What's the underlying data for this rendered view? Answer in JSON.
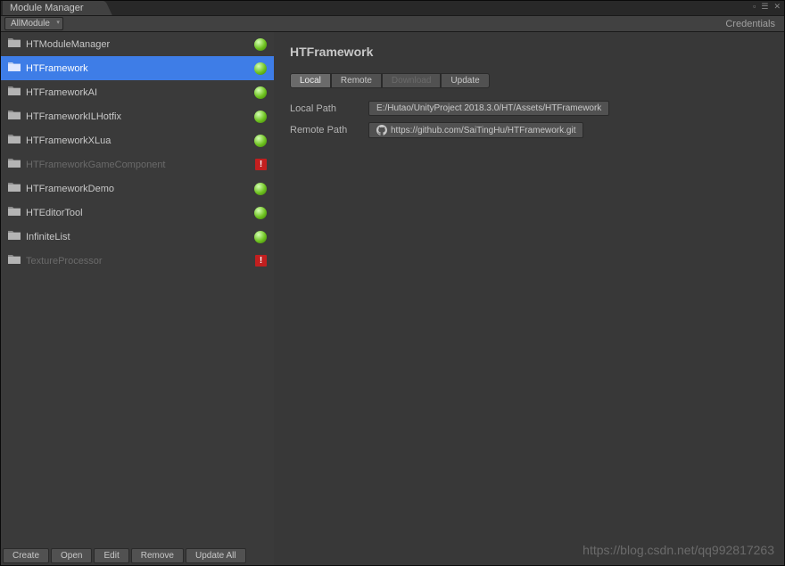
{
  "window": {
    "title": "Module Manager"
  },
  "toolbar": {
    "filterLabel": "AllModule",
    "credentialsLabel": "Credentials"
  },
  "modules": [
    {
      "name": "HTModuleManager",
      "status": "ok",
      "disabled": false,
      "selected": false
    },
    {
      "name": "HTFramework",
      "status": "ok",
      "disabled": false,
      "selected": true
    },
    {
      "name": "HTFrameworkAI",
      "status": "ok",
      "disabled": false,
      "selected": false
    },
    {
      "name": "HTFrameworkILHotfix",
      "status": "ok",
      "disabled": false,
      "selected": false
    },
    {
      "name": "HTFrameworkXLua",
      "status": "ok",
      "disabled": false,
      "selected": false
    },
    {
      "name": "HTFrameworkGameComponent",
      "status": "err",
      "disabled": true,
      "selected": false
    },
    {
      "name": "HTFrameworkDemo",
      "status": "ok",
      "disabled": false,
      "selected": false
    },
    {
      "name": "HTEditorTool",
      "status": "ok",
      "disabled": false,
      "selected": false
    },
    {
      "name": "InfiniteList",
      "status": "ok",
      "disabled": false,
      "selected": false
    },
    {
      "name": "TextureProcessor",
      "status": "err",
      "disabled": true,
      "selected": false
    }
  ],
  "footer": {
    "create": "Create",
    "open": "Open",
    "edit": "Edit",
    "remove": "Remove",
    "updateAll": "Update All"
  },
  "detail": {
    "title": "HTFramework",
    "tabs": {
      "local": "Local",
      "remote": "Remote",
      "download": "Download",
      "update": "Update"
    },
    "localPathLabel": "Local Path",
    "localPathValue": "E:/Hutao/UnityProject 2018.3.0/HT/Assets/HTFramework",
    "remotePathLabel": "Remote Path",
    "remotePathValue": "https://github.com/SaiTingHu/HTFramework.git"
  },
  "watermark": "https://blog.csdn.net/qq992817263"
}
